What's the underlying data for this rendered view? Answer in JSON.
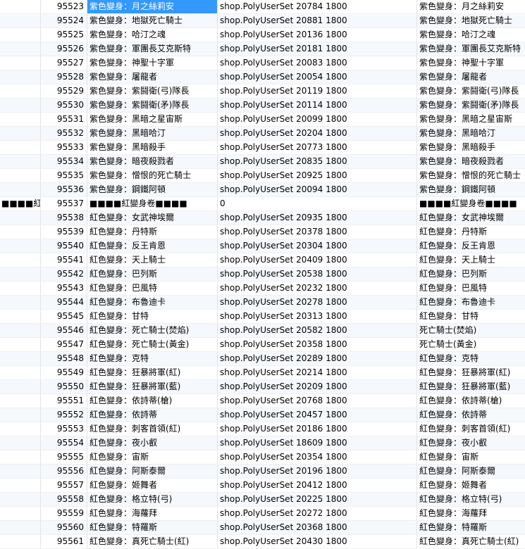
{
  "table": {
    "rows": [
      {
        "pre": "",
        "id": "95523",
        "name": "紫色變身：月之絲莉安",
        "action": "shop.PolyUserSet 20784 1800",
        "note": "紫色變身：月之絲莉安"
      },
      {
        "pre": "",
        "id": "95524",
        "name": "紫色變身：地獄死亡騎士",
        "action": "shop.PolyUserSet 20881 1800",
        "note": "紫色變身：地獄死亡騎士"
      },
      {
        "pre": "",
        "id": "95525",
        "name": "紫色變身：哈汀之魂",
        "action": "shop.PolyUserSet 20136 1800",
        "note": "紫色變身：哈汀之魂"
      },
      {
        "pre": "",
        "id": "95526",
        "name": "紫色變身：軍團長艾克斯特",
        "action": "shop.PolyUserSet 20181 1800",
        "note": "紫色變身：軍團長艾克斯特"
      },
      {
        "pre": "",
        "id": "95527",
        "name": "紫色變身：神聖十字軍",
        "action": "shop.PolyUserSet 20083 1800",
        "note": "紫色變身：神聖十字軍"
      },
      {
        "pre": "",
        "id": "95528",
        "name": "紫色變身：屠龍者",
        "action": "shop.PolyUserSet 20054 1800",
        "note": "紫色變身：屠龍者"
      },
      {
        "pre": "",
        "id": "95529",
        "name": "紫色變身：紫鬪衛(弓)隊長",
        "action": "shop.PolyUserSet 20119 1800",
        "note": "紫色變身：紫鬪衛(弓)隊長"
      },
      {
        "pre": "",
        "id": "95530",
        "name": "紫色變身：紫鬪衛(矛)隊長",
        "action": "shop.PolyUserSet 20114 1800",
        "note": "紫色變身：紫鬪衛(矛)隊長"
      },
      {
        "pre": "",
        "id": "95531",
        "name": "紫色變身：黑暗之星宙斯",
        "action": "shop.PolyUserSet 20099 1800",
        "note": "紫色變身：黑暗之星宙斯"
      },
      {
        "pre": "",
        "id": "95532",
        "name": "紫色變身：黑暗哈汀",
        "action": "shop.PolyUserSet 20204 1800",
        "note": "紫色變身：黑暗哈汀"
      },
      {
        "pre": "",
        "id": "95533",
        "name": "紫色變身：黑暗殺手",
        "action": "shop.PolyUserSet 20773 1800",
        "note": "紫色變身：黑暗殺手"
      },
      {
        "pre": "",
        "id": "95534",
        "name": "紫色變身：暗夜殺戮者",
        "action": "shop.PolyUserSet 20835 1800",
        "note": "紫色變身：暗夜殺戮者"
      },
      {
        "pre": "",
        "id": "95535",
        "name": "紫色變身：憎恨的死亡騎士",
        "action": "shop.PolyUserSet 20925 1800",
        "note": "紫色變身：憎恨的死亡騎士"
      },
      {
        "pre": "",
        "id": "95536",
        "name": "紫色變身：鋼鐵阿頓",
        "action": "shop.PolyUserSet 20094 1800",
        "note": "紫色變身：鋼鐵阿頓"
      },
      {
        "pre": "■■■■紅",
        "id": "95537",
        "name": "■■■■紅變身卷■■■■",
        "action": "0",
        "note": "■■■■紅變身卷■■■■"
      },
      {
        "pre": "",
        "id": "95538",
        "name": "紅色變身：女武神埃爾",
        "action": "shop.PolyUserSet 20935 1800",
        "note": "紅色變身：女武神埃爾"
      },
      {
        "pre": "",
        "id": "95539",
        "name": "紅色變身：丹特斯",
        "action": "shop.PolyUserSet 20378 1800",
        "note": "紅色變身：丹特斯"
      },
      {
        "pre": "",
        "id": "95540",
        "name": "紅色變身：反王肯恩",
        "action": "shop.PolyUserSet 20304 1800",
        "note": "紅色變身：反王肯恩"
      },
      {
        "pre": "",
        "id": "95541",
        "name": "紅色變身：天上騎士",
        "action": "shop.PolyUserSet 20409 1800",
        "note": "紅色變身：天上騎士"
      },
      {
        "pre": "",
        "id": "95542",
        "name": "紅色變身：巴列斯",
        "action": "shop.PolyUserSet 20538 1800",
        "note": "紅色變身：巴列斯"
      },
      {
        "pre": "",
        "id": "95543",
        "name": "紅色變身：巴風特",
        "action": "shop.PolyUserSet 20232 1800",
        "note": "紅色變身：巴風特"
      },
      {
        "pre": "",
        "id": "95544",
        "name": "紅色變身：布魯迪卡",
        "action": "shop.PolyUserSet 20278 1800",
        "note": "紅色變身：布魯迪卡"
      },
      {
        "pre": "",
        "id": "95545",
        "name": "紅色變身：甘特",
        "action": "shop.PolyUserSet 20313 1800",
        "note": "紅色變身：甘特"
      },
      {
        "pre": "",
        "id": "95546",
        "name": "紅色變身：死亡騎士(焚焰)",
        "action": "shop.PolyUserSet 20582 1800",
        "note": "死亡騎士(焚焰)"
      },
      {
        "pre": "",
        "id": "95547",
        "name": "紅色變身：死亡騎士(黃金)",
        "action": "shop.PolyUserSet 20358 1800",
        "note": "死亡騎士(黃金)"
      },
      {
        "pre": "",
        "id": "95548",
        "name": "紅色變身：克特",
        "action": "shop.PolyUserSet 20289 1800",
        "note": "紅色變身：克特"
      },
      {
        "pre": "",
        "id": "95549",
        "name": "紅色變身：狂暴將軍(紅)",
        "action": "shop.PolyUserSet 20214 1800",
        "note": "紅色變身：狂暴將軍(紅)"
      },
      {
        "pre": "",
        "id": "95550",
        "name": "紅色變身：狂暴將軍(藍)",
        "action": "shop.PolyUserSet 20209 1800",
        "note": "紅色變身：狂暴將軍(藍)"
      },
      {
        "pre": "",
        "id": "95551",
        "name": "紅色變身：依詩蒂(槍)",
        "action": "shop.PolyUserSet 20768 1800",
        "note": "紅色變身：依詩蒂(槍)"
      },
      {
        "pre": "",
        "id": "95552",
        "name": "紅色變身：依詩蒂",
        "action": "shop.PolyUserSet 20457 1800",
        "note": "紅色變身：依詩蒂"
      },
      {
        "pre": "",
        "id": "95553",
        "name": "紅色變身：刺客首領(紅)",
        "action": "shop.PolyUserSet 20186 1800",
        "note": "紅色變身：刺客首領(紅)"
      },
      {
        "pre": "",
        "id": "95554",
        "name": "紅色變身：夜小叡",
        "action": "shop.PolyUserSet 18609 1800",
        "note": "紅色變身：夜小叡"
      },
      {
        "pre": "",
        "id": "95555",
        "name": "紅色變身：宙斯",
        "action": "shop.PolyUserSet 20354 1800",
        "note": "紅色變身：宙斯"
      },
      {
        "pre": "",
        "id": "95556",
        "name": "紅色變身：阿斯泰爾",
        "action": "shop.PolyUserSet 20196 1800",
        "note": "紅色變身：阿斯泰爾"
      },
      {
        "pre": "",
        "id": "95557",
        "name": "紅色變身：姬舞者",
        "action": "shop.PolyUserSet 20412 1800",
        "note": "紅色變身：姬舞者"
      },
      {
        "pre": "",
        "id": "95558",
        "name": "紅色變身：格立特(弓)",
        "action": "shop.PolyUserSet 20225 1800",
        "note": "紅色變身：格立特(弓)"
      },
      {
        "pre": "",
        "id": "95559",
        "name": "紅色變身：海蘿拜",
        "action": "shop.PolyUserSet 20272 1800",
        "note": "紅色變身：海蘿拜"
      },
      {
        "pre": "",
        "id": "95560",
        "name": "紅色變身：特羅斯",
        "action": "shop.PolyUserSet 20368 1800",
        "note": "紅色變身：特羅斯"
      },
      {
        "pre": "",
        "id": "95561",
        "name": "紅色變身：真死亡騎士(紅)",
        "action": "shop.PolyUserSet 20430 1800",
        "note": "紅色變身：真死亡騎士(紅)"
      }
    ]
  },
  "colors": {
    "selection": "#3399ff",
    "alt_row": "#f5f8fd",
    "grid_line": "#e4e4e4"
  }
}
